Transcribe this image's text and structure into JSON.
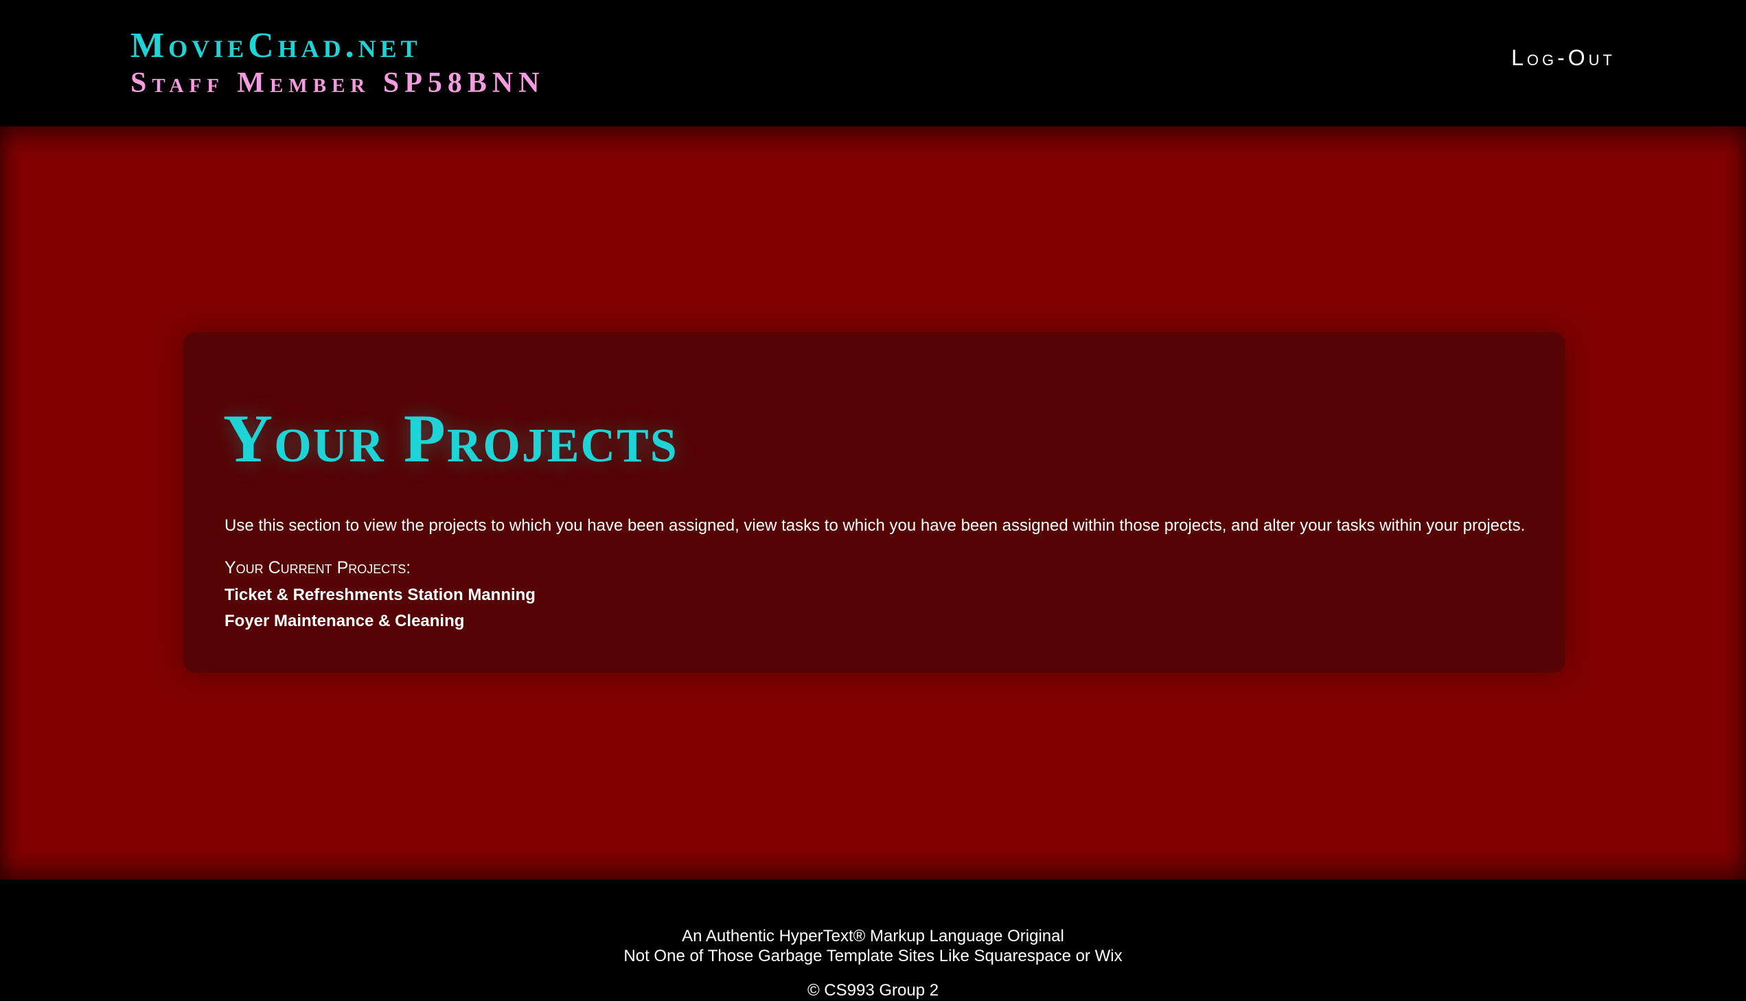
{
  "header": {
    "site_title": "MovieChad.net",
    "staff_label": "Staff Member SP58BNN",
    "logout_label": "Log-Out"
  },
  "main": {
    "title": "Your Projects",
    "intro": "Use this section to view the projects to which you have been assigned, view tasks to which you have been assigned within those projects, and alter your tasks within your projects.",
    "projects_heading": "Your Current Projects:",
    "projects": [
      "Ticket & Refreshments Station Manning",
      "Foyer Maintenance & Cleaning"
    ]
  },
  "footer": {
    "line1": "An Authentic HyperText® Markup Language Original",
    "line2": "Not One of Those Garbage Template Sites Like Squarespace or Wix",
    "line3": "© CS993 Group 2"
  },
  "colors": {
    "accent_cyan": "#1ed4d6",
    "accent_pink": "#f79be0",
    "background_red": "#800000",
    "panel_red": "#560303"
  }
}
